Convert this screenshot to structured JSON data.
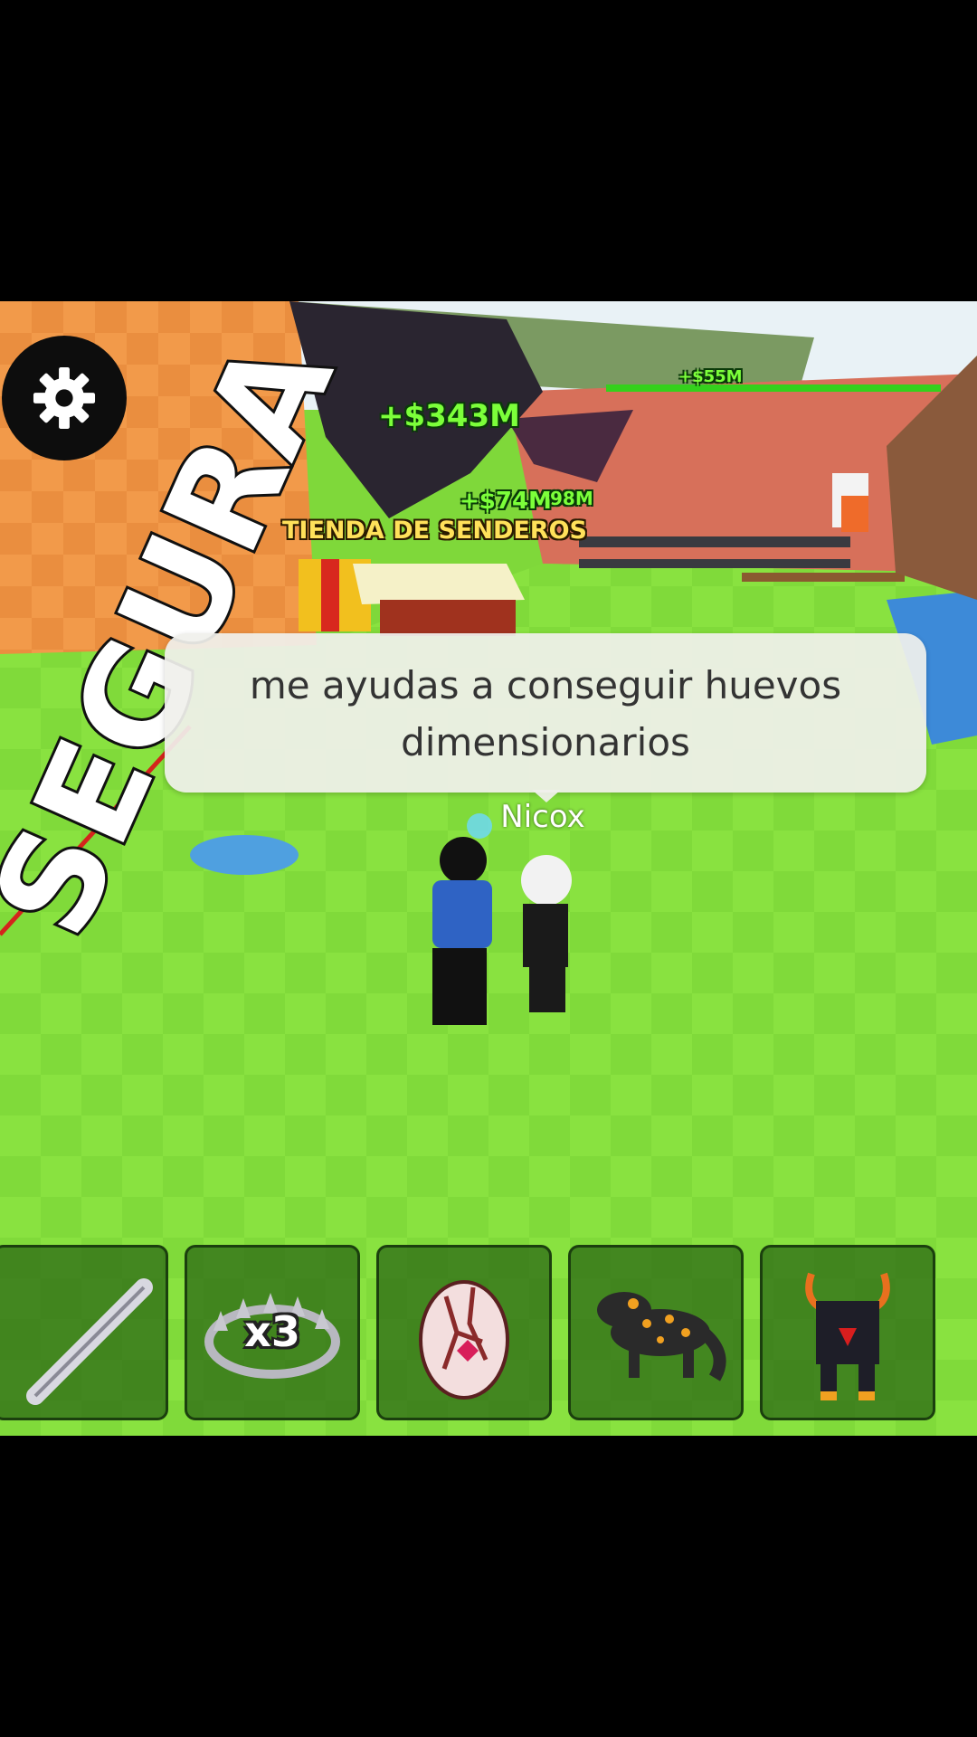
{
  "hud": {
    "settings_icon": "gear-icon",
    "money_popups": {
      "main": "+$343M",
      "mid": "+$74M",
      "mid_extra": "98M",
      "far": "+$55M"
    },
    "shop_sign": "TIENDA DE SENDEROS"
  },
  "chat": {
    "message": "me ayudas a conseguir huevos dimensionarios",
    "speaker": "Nicox"
  },
  "floor_text": "SEGURA",
  "hotbar": {
    "slots": [
      {
        "name": "bat",
        "icon": "bat-icon"
      },
      {
        "name": "trap",
        "icon": "bear-trap-icon",
        "count_label": "x3"
      },
      {
        "name": "egg",
        "icon": "egg-icon"
      },
      {
        "name": "salamander",
        "icon": "salamander-icon"
      },
      {
        "name": "bull",
        "icon": "bull-icon"
      }
    ]
  },
  "colors": {
    "grass": "#7fd83a",
    "wall": "#e88a3c",
    "money": "#7cff3a",
    "sign": "#ffe15a"
  }
}
